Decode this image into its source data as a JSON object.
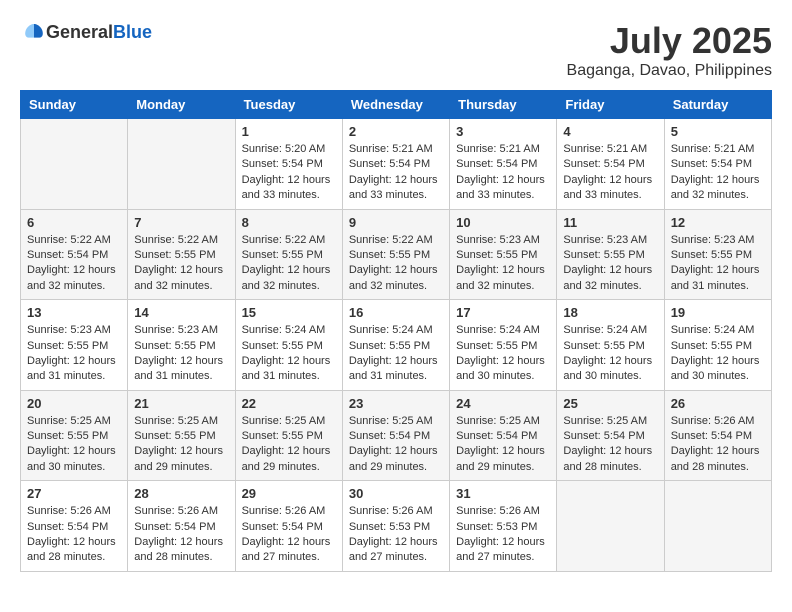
{
  "logo": {
    "general": "General",
    "blue": "Blue"
  },
  "title": "July 2025",
  "location": "Baganga, Davao, Philippines",
  "weekdays": [
    "Sunday",
    "Monday",
    "Tuesday",
    "Wednesday",
    "Thursday",
    "Friday",
    "Saturday"
  ],
  "weeks": [
    [
      {
        "day": "",
        "sunrise": "",
        "sunset": "",
        "daylight": ""
      },
      {
        "day": "",
        "sunrise": "",
        "sunset": "",
        "daylight": ""
      },
      {
        "day": "1",
        "sunrise": "Sunrise: 5:20 AM",
        "sunset": "Sunset: 5:54 PM",
        "daylight": "Daylight: 12 hours and 33 minutes."
      },
      {
        "day": "2",
        "sunrise": "Sunrise: 5:21 AM",
        "sunset": "Sunset: 5:54 PM",
        "daylight": "Daylight: 12 hours and 33 minutes."
      },
      {
        "day": "3",
        "sunrise": "Sunrise: 5:21 AM",
        "sunset": "Sunset: 5:54 PM",
        "daylight": "Daylight: 12 hours and 33 minutes."
      },
      {
        "day": "4",
        "sunrise": "Sunrise: 5:21 AM",
        "sunset": "Sunset: 5:54 PM",
        "daylight": "Daylight: 12 hours and 33 minutes."
      },
      {
        "day": "5",
        "sunrise": "Sunrise: 5:21 AM",
        "sunset": "Sunset: 5:54 PM",
        "daylight": "Daylight: 12 hours and 32 minutes."
      }
    ],
    [
      {
        "day": "6",
        "sunrise": "Sunrise: 5:22 AM",
        "sunset": "Sunset: 5:54 PM",
        "daylight": "Daylight: 12 hours and 32 minutes."
      },
      {
        "day": "7",
        "sunrise": "Sunrise: 5:22 AM",
        "sunset": "Sunset: 5:55 PM",
        "daylight": "Daylight: 12 hours and 32 minutes."
      },
      {
        "day": "8",
        "sunrise": "Sunrise: 5:22 AM",
        "sunset": "Sunset: 5:55 PM",
        "daylight": "Daylight: 12 hours and 32 minutes."
      },
      {
        "day": "9",
        "sunrise": "Sunrise: 5:22 AM",
        "sunset": "Sunset: 5:55 PM",
        "daylight": "Daylight: 12 hours and 32 minutes."
      },
      {
        "day": "10",
        "sunrise": "Sunrise: 5:23 AM",
        "sunset": "Sunset: 5:55 PM",
        "daylight": "Daylight: 12 hours and 32 minutes."
      },
      {
        "day": "11",
        "sunrise": "Sunrise: 5:23 AM",
        "sunset": "Sunset: 5:55 PM",
        "daylight": "Daylight: 12 hours and 32 minutes."
      },
      {
        "day": "12",
        "sunrise": "Sunrise: 5:23 AM",
        "sunset": "Sunset: 5:55 PM",
        "daylight": "Daylight: 12 hours and 31 minutes."
      }
    ],
    [
      {
        "day": "13",
        "sunrise": "Sunrise: 5:23 AM",
        "sunset": "Sunset: 5:55 PM",
        "daylight": "Daylight: 12 hours and 31 minutes."
      },
      {
        "day": "14",
        "sunrise": "Sunrise: 5:23 AM",
        "sunset": "Sunset: 5:55 PM",
        "daylight": "Daylight: 12 hours and 31 minutes."
      },
      {
        "day": "15",
        "sunrise": "Sunrise: 5:24 AM",
        "sunset": "Sunset: 5:55 PM",
        "daylight": "Daylight: 12 hours and 31 minutes."
      },
      {
        "day": "16",
        "sunrise": "Sunrise: 5:24 AM",
        "sunset": "Sunset: 5:55 PM",
        "daylight": "Daylight: 12 hours and 31 minutes."
      },
      {
        "day": "17",
        "sunrise": "Sunrise: 5:24 AM",
        "sunset": "Sunset: 5:55 PM",
        "daylight": "Daylight: 12 hours and 30 minutes."
      },
      {
        "day": "18",
        "sunrise": "Sunrise: 5:24 AM",
        "sunset": "Sunset: 5:55 PM",
        "daylight": "Daylight: 12 hours and 30 minutes."
      },
      {
        "day": "19",
        "sunrise": "Sunrise: 5:24 AM",
        "sunset": "Sunset: 5:55 PM",
        "daylight": "Daylight: 12 hours and 30 minutes."
      }
    ],
    [
      {
        "day": "20",
        "sunrise": "Sunrise: 5:25 AM",
        "sunset": "Sunset: 5:55 PM",
        "daylight": "Daylight: 12 hours and 30 minutes."
      },
      {
        "day": "21",
        "sunrise": "Sunrise: 5:25 AM",
        "sunset": "Sunset: 5:55 PM",
        "daylight": "Daylight: 12 hours and 29 minutes."
      },
      {
        "day": "22",
        "sunrise": "Sunrise: 5:25 AM",
        "sunset": "Sunset: 5:55 PM",
        "daylight": "Daylight: 12 hours and 29 minutes."
      },
      {
        "day": "23",
        "sunrise": "Sunrise: 5:25 AM",
        "sunset": "Sunset: 5:54 PM",
        "daylight": "Daylight: 12 hours and 29 minutes."
      },
      {
        "day": "24",
        "sunrise": "Sunrise: 5:25 AM",
        "sunset": "Sunset: 5:54 PM",
        "daylight": "Daylight: 12 hours and 29 minutes."
      },
      {
        "day": "25",
        "sunrise": "Sunrise: 5:25 AM",
        "sunset": "Sunset: 5:54 PM",
        "daylight": "Daylight: 12 hours and 28 minutes."
      },
      {
        "day": "26",
        "sunrise": "Sunrise: 5:26 AM",
        "sunset": "Sunset: 5:54 PM",
        "daylight": "Daylight: 12 hours and 28 minutes."
      }
    ],
    [
      {
        "day": "27",
        "sunrise": "Sunrise: 5:26 AM",
        "sunset": "Sunset: 5:54 PM",
        "daylight": "Daylight: 12 hours and 28 minutes."
      },
      {
        "day": "28",
        "sunrise": "Sunrise: 5:26 AM",
        "sunset": "Sunset: 5:54 PM",
        "daylight": "Daylight: 12 hours and 28 minutes."
      },
      {
        "day": "29",
        "sunrise": "Sunrise: 5:26 AM",
        "sunset": "Sunset: 5:54 PM",
        "daylight": "Daylight: 12 hours and 27 minutes."
      },
      {
        "day": "30",
        "sunrise": "Sunrise: 5:26 AM",
        "sunset": "Sunset: 5:53 PM",
        "daylight": "Daylight: 12 hours and 27 minutes."
      },
      {
        "day": "31",
        "sunrise": "Sunrise: 5:26 AM",
        "sunset": "Sunset: 5:53 PM",
        "daylight": "Daylight: 12 hours and 27 minutes."
      },
      {
        "day": "",
        "sunrise": "",
        "sunset": "",
        "daylight": ""
      },
      {
        "day": "",
        "sunrise": "",
        "sunset": "",
        "daylight": ""
      }
    ]
  ]
}
